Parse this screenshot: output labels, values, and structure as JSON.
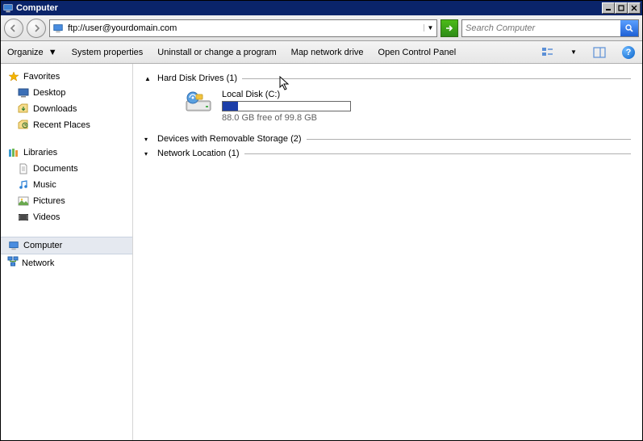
{
  "title": "Computer",
  "address_value": "ftp://user@yourdomain.com",
  "search_placeholder": "Search Computer",
  "cmdbar": {
    "organize": "Organize",
    "system_properties": "System properties",
    "uninstall": "Uninstall or change a program",
    "map_drive": "Map network drive",
    "control_panel": "Open Control Panel"
  },
  "sidebar": {
    "favorites": {
      "label": "Favorites",
      "items": [
        {
          "label": "Desktop"
        },
        {
          "label": "Downloads"
        },
        {
          "label": "Recent Places"
        }
      ]
    },
    "libraries": {
      "label": "Libraries",
      "items": [
        {
          "label": "Documents"
        },
        {
          "label": "Music"
        },
        {
          "label": "Pictures"
        },
        {
          "label": "Videos"
        }
      ]
    },
    "computer": {
      "label": "Computer"
    },
    "network": {
      "label": "Network"
    }
  },
  "content": {
    "groups": [
      {
        "label": "Hard Disk Drives (1)",
        "expanded": true
      },
      {
        "label": "Devices with Removable Storage (2)",
        "expanded": false
      },
      {
        "label": "Network Location (1)",
        "expanded": false
      }
    ],
    "drive": {
      "name": "Local Disk (C:)",
      "free_text": "88.0 GB free of 99.8 GB",
      "used_pct": 12
    }
  }
}
